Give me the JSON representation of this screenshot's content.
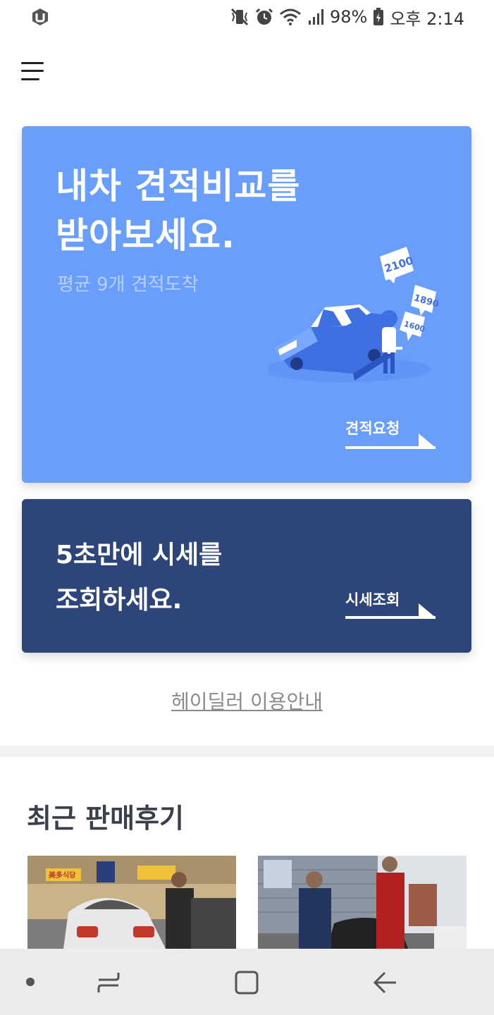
{
  "status_bar": {
    "battery": "98%",
    "time": "오후 2:14",
    "icons": [
      "app-notification-icon",
      "vibrate-mute-icon",
      "alarm-icon",
      "wifi-icon",
      "signal-icon",
      "battery-charging-icon"
    ]
  },
  "menu": {
    "icon": "hamburger-menu-icon"
  },
  "estimate_card": {
    "title": "내차 견적비교를\n받아보세요.",
    "subtitle": "평균 9개 견적도착",
    "bubbles": [
      "2100",
      "1890",
      "1600"
    ],
    "cta": "견적요청",
    "bg_color": "#6a9efc"
  },
  "price_card": {
    "title": "5초만에 시세를\n조회하세요.",
    "cta": "시세조회",
    "bg_color": "#2e457a"
  },
  "guide_link": "헤이딜러 이용안내",
  "reviews": {
    "title": "최근 판매후기",
    "sign_text": "美多식당"
  },
  "nav_bar": {
    "items": [
      "dot-icon",
      "recent-apps-icon",
      "home-icon",
      "back-icon"
    ]
  }
}
